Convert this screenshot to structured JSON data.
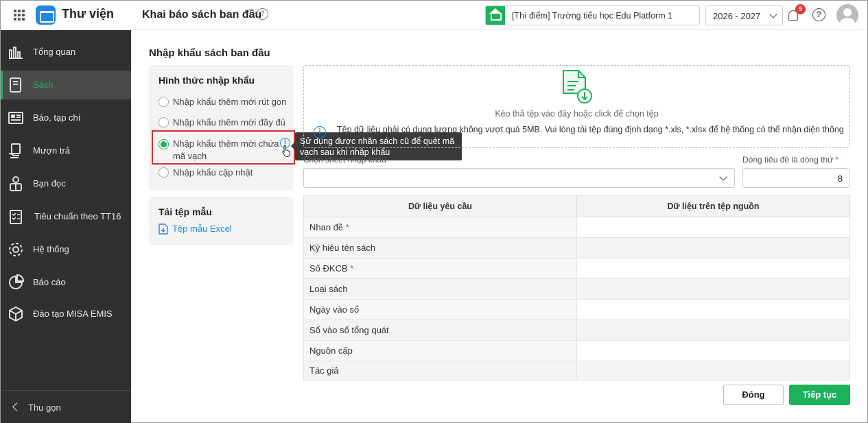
{
  "header": {
    "app_title": "Thư viện",
    "page_title": "Khai báo sách ban đầu",
    "school": "[Thí điểm] Trường tiểu học Edu Platform 1",
    "year": "2026 - 2027",
    "notification_count": "5",
    "help_glyph": "?",
    "accent_color": "#1bb25a"
  },
  "sidebar": {
    "items": [
      {
        "label": "Tổng quan",
        "icon": "chart-bar-icon"
      },
      {
        "label": "Sách",
        "icon": "book-icon"
      },
      {
        "label": "Báo, tạp chí",
        "icon": "newspaper-icon"
      },
      {
        "label": "Mượn trả",
        "icon": "hand-book-icon"
      },
      {
        "label": "Bạn đọc",
        "icon": "reader-icon"
      },
      {
        "label": "Tiêu chuẩn theo TT16",
        "icon": "checklist-icon"
      },
      {
        "label": "Hệ thống",
        "icon": "gear-icon"
      },
      {
        "label": "Báo cáo",
        "icon": "pie-chart-icon"
      },
      {
        "label": "Đào tạo MISA EMIS",
        "icon": "cube-icon"
      }
    ],
    "active_index": 1,
    "collapse_label": "Thu gọn"
  },
  "main": {
    "title": "Nhập khẩu sách ban đầu",
    "import_type": {
      "heading": "Hình thức nhập khẩu",
      "options": [
        "Nhập khẩu thêm mới rút gọn",
        "Nhập khẩu thêm mới đầy đủ",
        "Nhập khẩu thêm mới chứa",
        "mã vạch",
        "Nhập khẩu cập nhật"
      ],
      "selected_index": 2,
      "tooltip_line1": "Sử dụng được nhãn sách cũ để quét mã",
      "tooltip_line2": "vạch sau khi nhập khẩu",
      "info_glyph": "i"
    },
    "template": {
      "heading": "Tải tệp mẫu",
      "link": "Tệp mẫu Excel"
    },
    "dropzone": {
      "text": "Kéo thả tệp vào đây hoặc click để chọn tệp",
      "note": "Tệp dữ liệu phải có dung lượng không vượt quá 5MB. Vui lòng tải tệp đúng định dạng *.xls, *.xlsx để hệ thống có thể nhận diện thông"
    },
    "sheet_label": "Chọn sheet nhập khẩu",
    "header_row_label": "Dòng tiêu đề là dòng thứ",
    "required_mark": "*",
    "header_row_value": "8",
    "table": {
      "col_required": "Dữ liệu yêu cầu",
      "col_source": "Dữ liệu trên tệp nguồn",
      "rows": [
        {
          "label": "Nhan đề",
          "required": true
        },
        {
          "label": "Ký hiệu tên sách",
          "required": false
        },
        {
          "label": "Số ĐKCB",
          "required": true
        },
        {
          "label": "Loại sách",
          "required": false
        },
        {
          "label": "Ngày vào sổ",
          "required": false
        },
        {
          "label": "Số vào sổ tổng quát",
          "required": false
        },
        {
          "label": "Nguồn cấp",
          "required": false
        },
        {
          "label": "Tác giả",
          "required": false
        }
      ]
    },
    "buttons": {
      "close": "Đóng",
      "next": "Tiếp tục"
    }
  }
}
